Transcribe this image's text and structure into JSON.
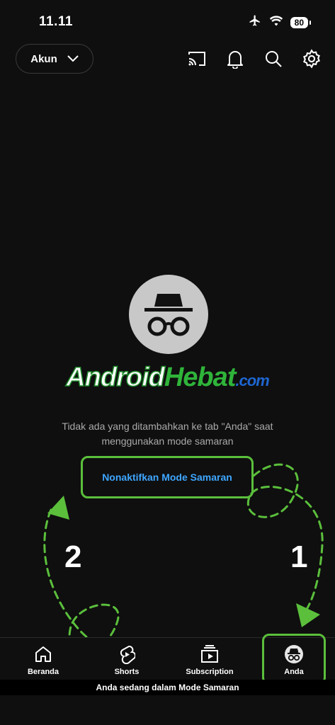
{
  "status": {
    "time": "11.11",
    "battery": "80"
  },
  "header": {
    "account_label": "Akun",
    "icons": [
      "cast-icon",
      "bell-icon",
      "search-icon",
      "gear-icon"
    ]
  },
  "empty_state": {
    "icon": "incognito-icon",
    "line1": "Tidak ada yang ditambahkan ke tab \"Anda\" saat",
    "line2": "menggunakan mode samaran",
    "disable_button": "Nonaktifkan Mode Samaran"
  },
  "watermark": {
    "part_a": "Android",
    "part_b": "Hebat",
    "part_c": ".com"
  },
  "annotations": {
    "step1": "1",
    "step2": "2",
    "color": "#5bbf3c"
  },
  "nav": [
    {
      "label": "Beranda",
      "icon": "home-icon"
    },
    {
      "label": "Shorts",
      "icon": "shorts-icon"
    },
    {
      "label": "Subscription",
      "icon": "subscriptions-icon"
    },
    {
      "label": "Anda",
      "icon": "incognito-avatar-icon"
    }
  ],
  "incognito_banner": "Anda sedang dalam Mode Samaran"
}
